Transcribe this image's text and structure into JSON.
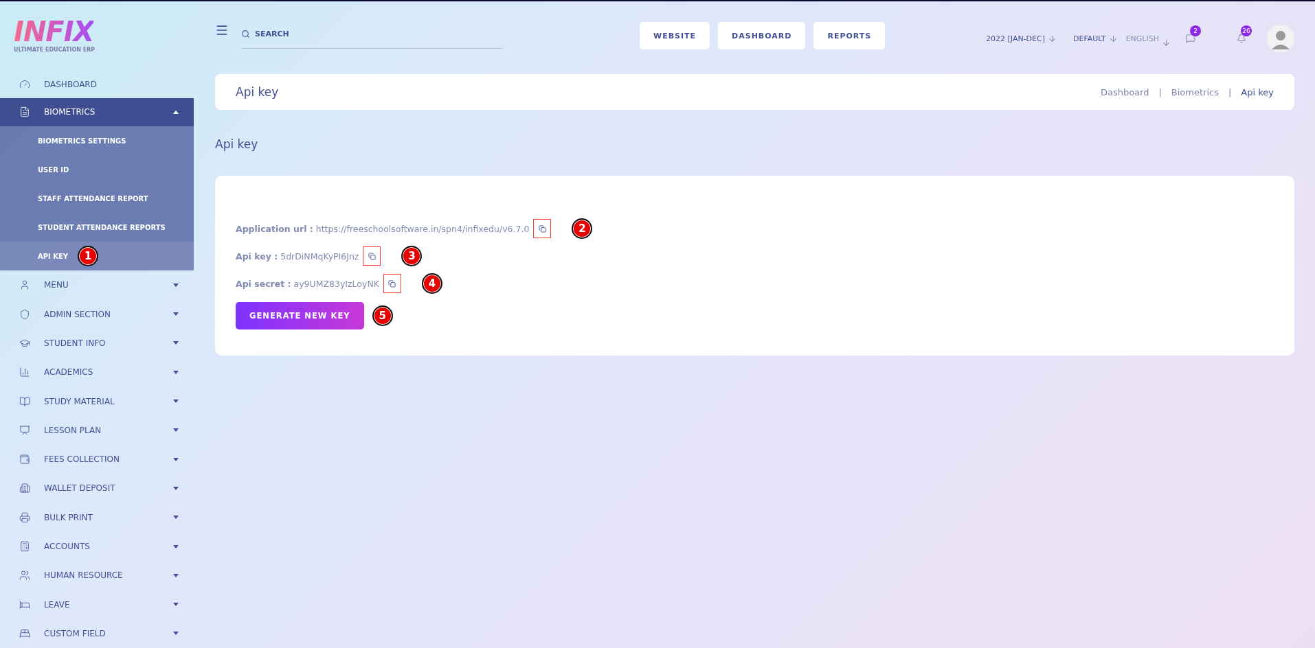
{
  "logo": {
    "name": "INFIX",
    "tagline": "ULTIMATE EDUCATION ERP"
  },
  "sidebar": {
    "items": [
      {
        "label": "DASHBOARD",
        "expanded": false,
        "has_caret": false
      },
      {
        "label": "BIOMETRICS",
        "expanded": true,
        "has_caret": true,
        "children": [
          {
            "label": "BIOMETRICS SETTINGS",
            "selected": false
          },
          {
            "label": "USER ID",
            "selected": false
          },
          {
            "label": "STAFF ATTENDANCE REPORT",
            "selected": false
          },
          {
            "label": "STUDENT ATTENDANCE REPORTS",
            "selected": false
          },
          {
            "label": "API KEY",
            "selected": true,
            "marker": "1"
          }
        ]
      },
      {
        "label": "MENU",
        "expanded": false,
        "has_caret": true
      },
      {
        "label": "ADMIN SECTION",
        "expanded": false,
        "has_caret": true
      },
      {
        "label": "STUDENT INFO",
        "expanded": false,
        "has_caret": true
      },
      {
        "label": "ACADEMICS",
        "expanded": false,
        "has_caret": true
      },
      {
        "label": "STUDY MATERIAL",
        "expanded": false,
        "has_caret": true
      },
      {
        "label": "LESSON PLAN",
        "expanded": false,
        "has_caret": true
      },
      {
        "label": "FEES COLLECTION",
        "expanded": false,
        "has_caret": true
      },
      {
        "label": "WALLET DEPOSIT",
        "expanded": false,
        "has_caret": true
      },
      {
        "label": "BULK PRINT",
        "expanded": false,
        "has_caret": true
      },
      {
        "label": "ACCOUNTS",
        "expanded": false,
        "has_caret": true
      },
      {
        "label": "HUMAN RESOURCE",
        "expanded": false,
        "has_caret": true
      },
      {
        "label": "LEAVE",
        "expanded": false,
        "has_caret": true
      },
      {
        "label": "CUSTOM FIELD",
        "expanded": false,
        "has_caret": true
      }
    ]
  },
  "topbar": {
    "search": {
      "placeholder": "SEARCH"
    },
    "buttons": [
      "WEBSITE",
      "DASHBOARD",
      "REPORTS"
    ],
    "session": "2022 [JAN-DEC]",
    "theme": "DEFAULT",
    "language": "ENGLISH",
    "messages_badge": "2",
    "notifications_badge": "26"
  },
  "header": {
    "title": "Api key",
    "breadcrumbs": [
      "Dashboard",
      "Biometrics",
      "Api key"
    ],
    "separators": [
      "|",
      "|"
    ]
  },
  "section_title": "Api key",
  "card": {
    "rows": [
      {
        "label": "Application url :",
        "value": "https://freeschoolsoftware.in/spn4/infixedu/v6.7.0",
        "highlighted": true,
        "marker": "2"
      },
      {
        "label": "Api key :",
        "value": "5drDiNMqKyPI6Jnz",
        "highlighted": true,
        "marker": "3"
      },
      {
        "label": "Api secret :",
        "value": "ay9UMZ83yIzLoyNK",
        "highlighted": true,
        "marker": "4"
      }
    ],
    "button": {
      "label": "GENERATE NEW KEY",
      "marker": "5"
    }
  }
}
